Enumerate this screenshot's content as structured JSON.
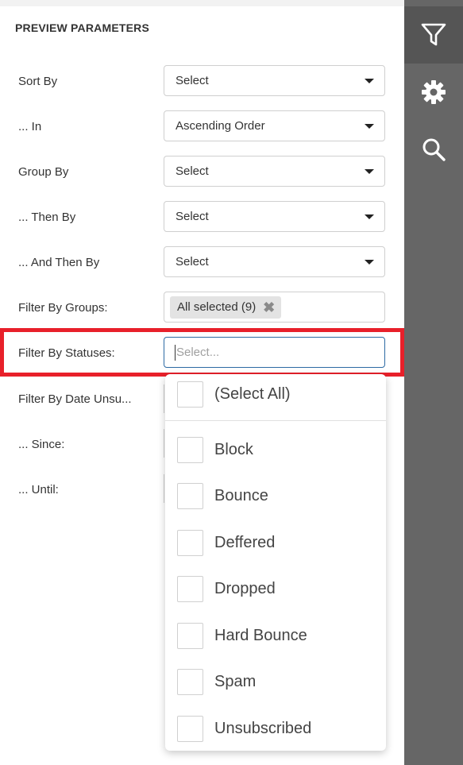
{
  "panel": {
    "title": "PREVIEW PARAMETERS"
  },
  "rows": {
    "sort_by": {
      "label": "Sort By",
      "value": "Select"
    },
    "in": {
      "label": "... In",
      "value": "Ascending Order"
    },
    "group_by": {
      "label": "Group By",
      "value": "Select"
    },
    "then_by": {
      "label": "... Then By",
      "value": "Select"
    },
    "and_then_by": {
      "label": "... And Then By",
      "value": "Select"
    },
    "filter_groups": {
      "label": "Filter By Groups:",
      "chip": "All selected (9)"
    },
    "filter_statuses": {
      "label": "Filter By Statuses:",
      "placeholder": "Select..."
    },
    "filter_date": {
      "label": "Filter By Date Unsu..."
    },
    "since": {
      "label": "... Since:"
    },
    "until": {
      "label": "... Until:"
    }
  },
  "dropdown": {
    "select_all": "(Select All)",
    "options": [
      "Block",
      "Bounce",
      "Deffered",
      "Dropped",
      "Hard Bounce",
      "Spam",
      "Unsubscribed"
    ]
  },
  "sidebar": {
    "icons": [
      "filter-icon",
      "gear-icon",
      "search-icon"
    ]
  },
  "colors": {
    "highlight": "#e8202a",
    "sidebar": "#666666",
    "sidebar_active": "#555555",
    "focus_border": "#2d6aa3"
  }
}
